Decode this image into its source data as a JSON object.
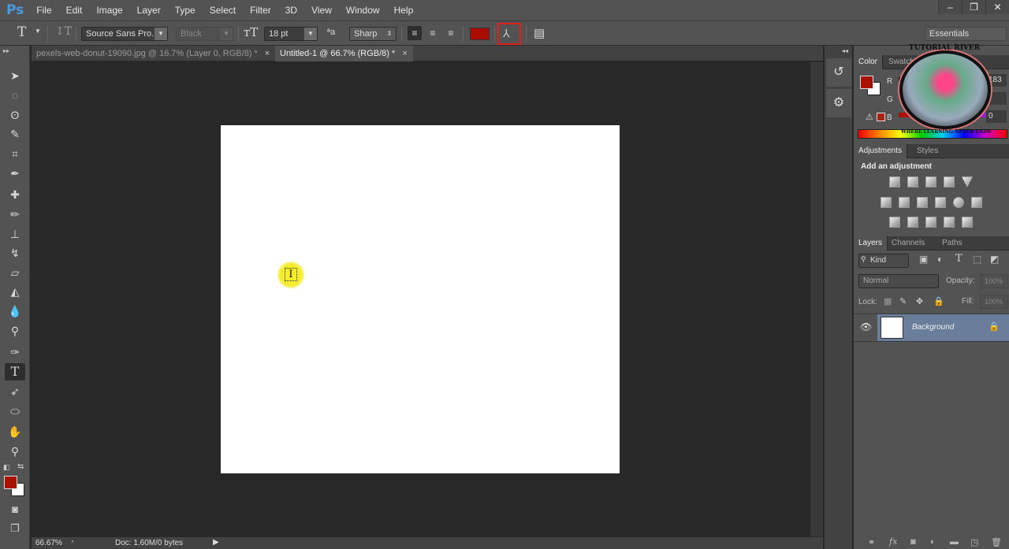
{
  "app": {
    "logo": "Ps"
  },
  "menu": [
    "File",
    "Edit",
    "Image",
    "Layer",
    "Type",
    "Select",
    "Filter",
    "3D",
    "View",
    "Window",
    "Help"
  ],
  "window_controls": {
    "minimize": "–",
    "restore": "❐",
    "close": "✕"
  },
  "options": {
    "tool_icon": "T",
    "font_family": "Source Sans Pro...",
    "font_style": "Black",
    "font_size": "18 pt",
    "antialias": "Sharp",
    "text_color": "#aa0c00",
    "workspace": "Essentials"
  },
  "tabs": [
    {
      "label": "pexels-web-donut-19090.jpg @ 16.7% (Layer 0, RGB/8) *",
      "close": "×",
      "active": false
    },
    {
      "label": "Untitled-1 @ 66.7% (RGB/8) *",
      "close": "×",
      "active": true
    }
  ],
  "status": {
    "zoom": "66.67%",
    "doc": "Doc: 1.60M/0 bytes"
  },
  "colors": {
    "foreground": "#aa1100",
    "background": "#ffffff"
  },
  "color_panel": {
    "tabs": [
      "Color",
      "Swatches"
    ],
    "channels": [
      {
        "label": "R",
        "value": "183"
      },
      {
        "label": "G",
        "value": ""
      },
      {
        "label": "B",
        "value": "0"
      }
    ]
  },
  "adjustments_panel": {
    "tabs": [
      "Adjustments",
      "Styles"
    ],
    "heading": "Add an adjustment"
  },
  "layers_panel": {
    "tabs": [
      "Layers",
      "Channels",
      "Paths"
    ],
    "filter": "Kind",
    "blend_mode": "Normal",
    "opacity_label": "Opacity:",
    "opacity": "100%",
    "lock_label": "Lock:",
    "fill_label": "Fill:",
    "fill": "100%",
    "layers": [
      {
        "name": "Background",
        "visible": true,
        "locked": true
      }
    ]
  },
  "watermark": {
    "text_top": "TUTORIAL RIVER",
    "text_bottom": "WHERE LEARNING NEVER ENDS"
  }
}
